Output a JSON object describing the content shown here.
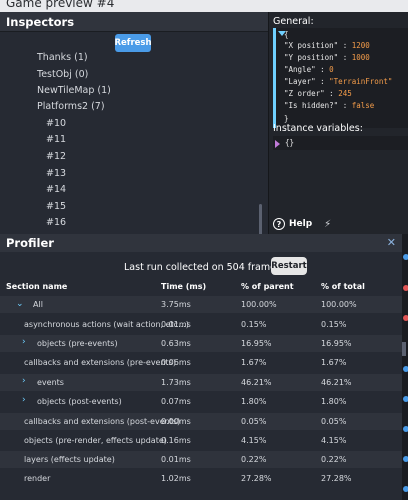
{
  "window": {
    "title": "Game preview #4"
  },
  "inspectors": {
    "title": "Inspectors",
    "refresh_label": "Refresh",
    "tree": [
      "Thanks (1)",
      "TestObj (0)",
      "NewTileMap (1)",
      "Platforms2 (7)",
      "#10",
      "#11",
      "#12",
      "#13",
      "#14",
      "#15",
      "#16"
    ]
  },
  "details": {
    "general_label": "General:",
    "open_brace": "{",
    "close_brace": "}",
    "props": [
      {
        "key": "\"X position\"",
        "value": "1200",
        "kind": "num"
      },
      {
        "key": "\"Y position\"",
        "value": "1000",
        "kind": "num"
      },
      {
        "key": "\"Angle\"",
        "value": "0",
        "kind": "num"
      },
      {
        "key": "\"Layer\"",
        "value": "\"TerrainFront\"",
        "kind": "str"
      },
      {
        "key": "\"Z order\"",
        "value": "245",
        "kind": "num"
      },
      {
        "key": "\"Is hidden?\"",
        "value": "false",
        "kind": "bool"
      }
    ],
    "instance_vars_label": "Instance variables:",
    "instance_vars_value": "{}",
    "help_label": "Help"
  },
  "profiler": {
    "title": "Profiler",
    "last_run": "Last run collected on 504 frames.",
    "restart_label": "Restart",
    "columns": [
      "Section name",
      "Time (ms)",
      "% of parent",
      "% of total"
    ],
    "rows": [
      {
        "name": "All",
        "time": "3.75ms",
        "parent": "100.00%",
        "total": "100.00%",
        "chevron": "down"
      },
      {
        "name": "asynchronous actions (wait action, etc...)",
        "time": "0.01ms",
        "parent": "0.15%",
        "total": "0.15%",
        "chevron": ""
      },
      {
        "name": "objects (pre-events)",
        "time": "0.63ms",
        "parent": "16.95%",
        "total": "16.95%",
        "chevron": "right"
      },
      {
        "name": "callbacks and extensions (pre-events)",
        "time": "0.06ms",
        "parent": "1.67%",
        "total": "1.67%",
        "chevron": ""
      },
      {
        "name": "events",
        "time": "1.73ms",
        "parent": "46.21%",
        "total": "46.21%",
        "chevron": "right"
      },
      {
        "name": "objects (post-events)",
        "time": "0.07ms",
        "parent": "1.80%",
        "total": "1.80%",
        "chevron": "right"
      },
      {
        "name": "callbacks and extensions (post-events)",
        "time": "0.00ms",
        "parent": "0.05%",
        "total": "0.05%",
        "chevron": ""
      },
      {
        "name": "objects (pre-render, effects update)",
        "time": "0.16ms",
        "parent": "4.15%",
        "total": "4.15%",
        "chevron": ""
      },
      {
        "name": "layers (effects update)",
        "time": "0.01ms",
        "parent": "0.22%",
        "total": "0.22%",
        "chevron": ""
      },
      {
        "name": "render",
        "time": "1.02ms",
        "parent": "27.28%",
        "total": "27.28%",
        "chevron": ""
      }
    ]
  },
  "colors": {
    "accent": "#4a9be8",
    "number": "#f39c4a",
    "caret": "#6fd0ff"
  }
}
